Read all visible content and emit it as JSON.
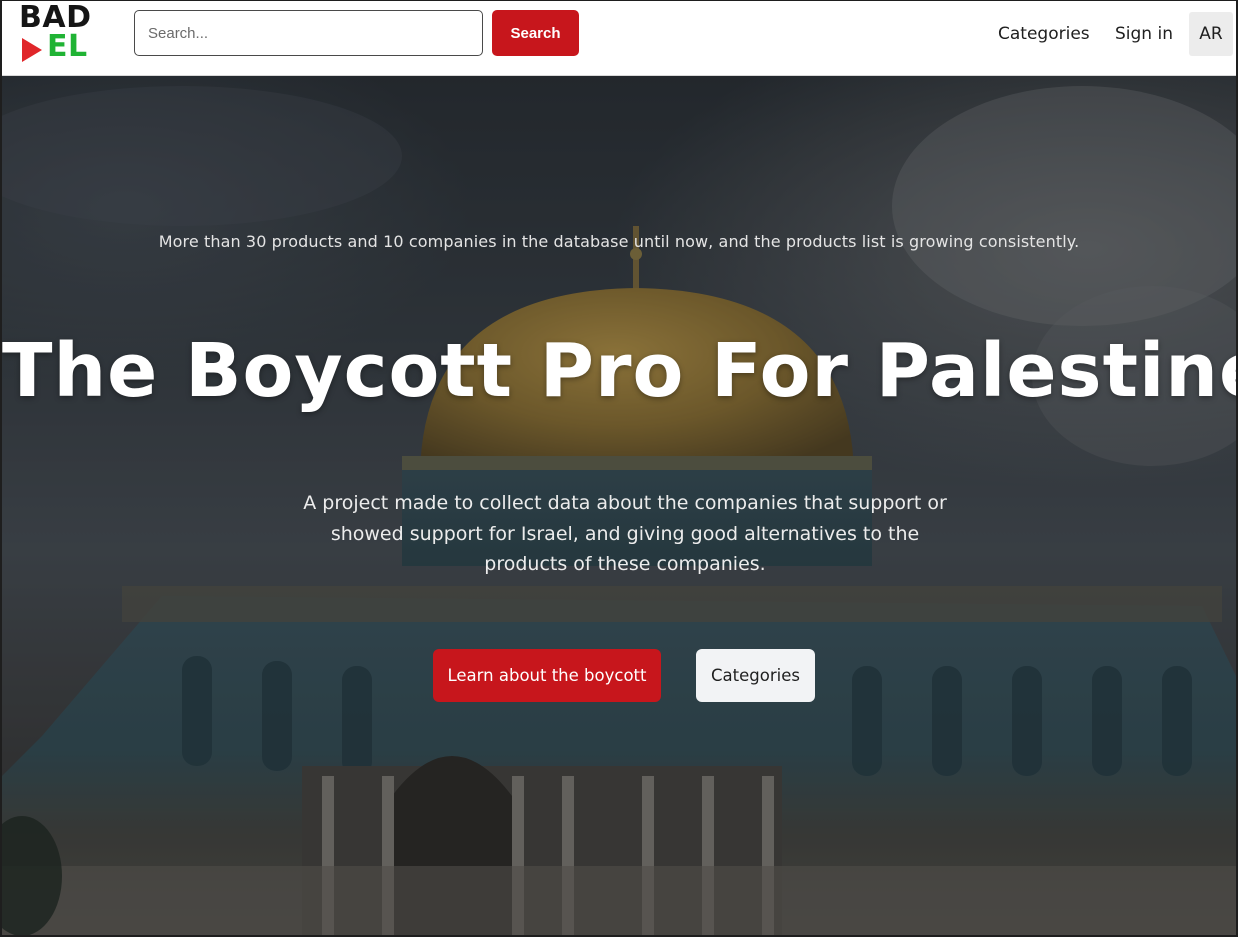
{
  "brand": {
    "logo_top": "BAD",
    "logo_bottom": "EL",
    "colors": {
      "play": "#e0262a",
      "bottom": "#20b334",
      "top": "#151515"
    }
  },
  "search": {
    "placeholder": "Search...",
    "button_label": "Search"
  },
  "nav": {
    "categories_label": "Categories",
    "signin_label": "Sign in",
    "language_label": "AR"
  },
  "hero": {
    "stats_text": "More than 30 products and 10 companies in the database until now, and the products list is growing consistently.",
    "title": "The Boycott Pro For Palestine.",
    "description": "A project made to collect data about the companies that support or showed support for Israel, and giving good alternatives to the products of these companies.",
    "cta_label": "Learn about the boycott",
    "categories_label": "Categories"
  },
  "theme": {
    "accent": "#c7161c",
    "light_button": "#f2f3f5"
  }
}
